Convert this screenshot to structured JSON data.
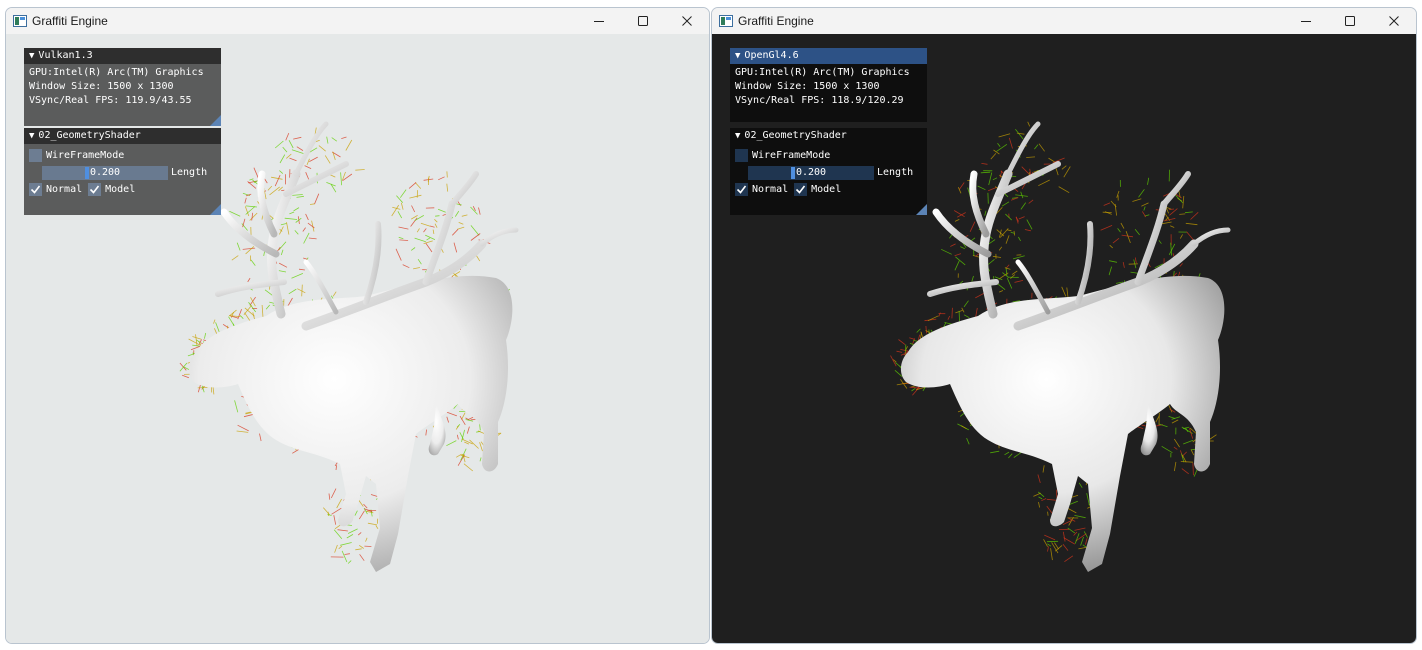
{
  "windows": [
    {
      "id": "left",
      "title": "Graffiti Engine",
      "background": "#e5e8e8",
      "info_panel": {
        "title": "Vulkan1.3",
        "gpu": "GPU:Intel(R) Arc(TM) Graphics",
        "window_size": "Window Size: 1500 x 1300",
        "fps": "VSync/Real FPS: 119.9/43.55"
      },
      "controls_panel": {
        "title": "02_GeometryShader",
        "wireframe_label": "WireFrameMode",
        "wireframe_checked": false,
        "length_value": "0.200",
        "length_label": "Length",
        "normal_label": "Normal",
        "normal_checked": true,
        "model_label": "Model",
        "model_checked": true
      }
    },
    {
      "id": "right",
      "title": "Graffiti Engine",
      "background": "#1f1f1f",
      "info_panel": {
        "title": "OpenGl4.6",
        "gpu": "GPU:Intel(R) Arc(TM) Graphics",
        "window_size": "Window Size: 1500 x 1300",
        "fps": "VSync/Real FPS: 118.9/120.29"
      },
      "controls_panel": {
        "title": "02_GeometryShader",
        "wireframe_label": "WireFrameMode",
        "wireframe_checked": false,
        "length_value": "0.200",
        "length_label": "Length",
        "normal_label": "Normal",
        "normal_checked": true,
        "model_label": "Model",
        "model_checked": true
      }
    }
  ],
  "icons": {
    "app": "graffiti-engine-icon",
    "minimize": "minimize-icon",
    "maximize": "maximize-icon",
    "close": "close-icon",
    "collapse": "collapse-triangle-icon",
    "check": "checkmark-icon"
  },
  "colors": {
    "normal_lines": [
      "#5fd000",
      "#d8351c",
      "#c8a000"
    ],
    "accent": "#4f8fe0",
    "active_header": "#2d5286"
  }
}
